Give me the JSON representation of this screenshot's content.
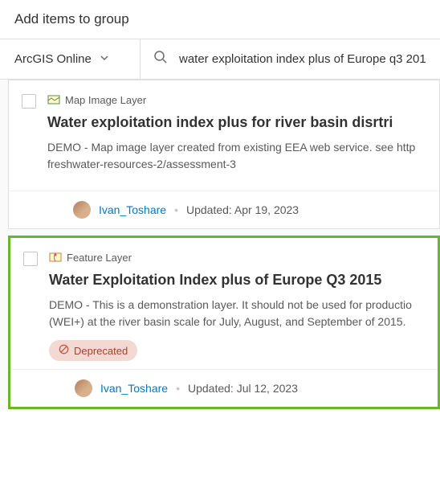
{
  "dialog": {
    "title": "Add items to group"
  },
  "filter": {
    "scope_label": "ArcGIS Online",
    "search_value": "water exploitation index plus of Europe q3 201"
  },
  "results": [
    {
      "type_label": "Map Image Layer",
      "type_icon": "map-image-layer-icon",
      "title": "Water exploitation index plus for river basin disrtri",
      "description": "DEMO - Map image layer created from existing EEA web service. see http freshwater-resources-2/assessment-3",
      "owner": "Ivan_Toshare",
      "updated_label": "Updated:",
      "updated_date": "Apr 19, 2023",
      "deprecated": false,
      "highlighted": false
    },
    {
      "type_label": "Feature Layer",
      "type_icon": "feature-layer-icon",
      "title": "Water Exploitation Index plus of Europe Q3 2015",
      "description": "DEMO - This is a demonstration layer. It should not be used for productio (WEI+) at the river basin scale for July, August, and September of 2015.",
      "owner": "Ivan_Toshare",
      "updated_label": "Updated:",
      "updated_date": "Jul 12, 2023",
      "deprecated": true,
      "deprecated_label": "Deprecated",
      "highlighted": true
    }
  ]
}
